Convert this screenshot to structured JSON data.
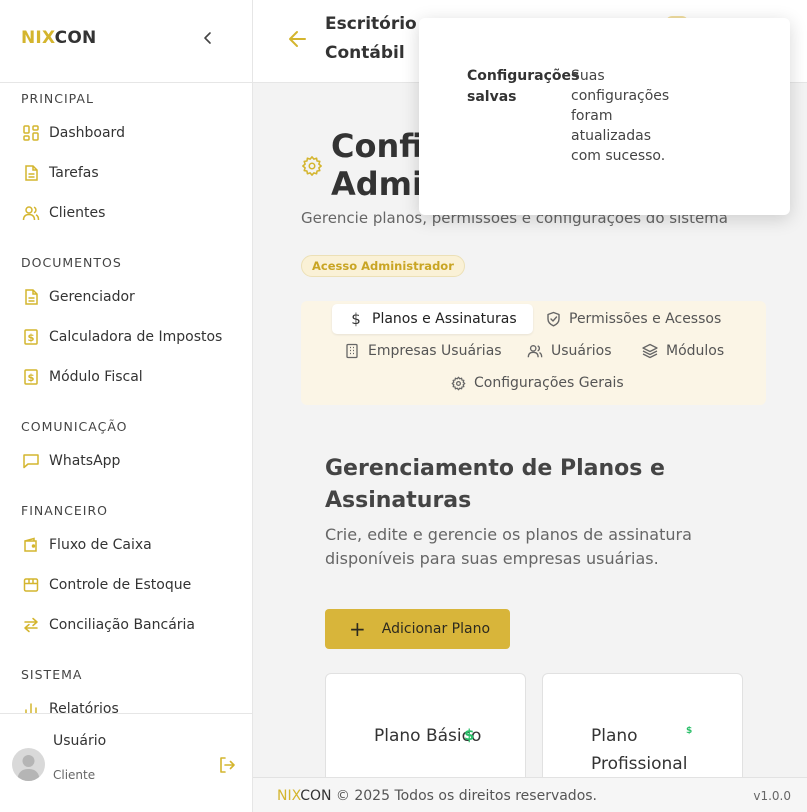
{
  "brand": {
    "part1": "NIX",
    "part2": "CON"
  },
  "sidebar": {
    "sections": [
      {
        "title": "PRINCIPAL",
        "items": [
          {
            "label": "Dashboard",
            "icon": "dashboard-icon"
          },
          {
            "label": "Tarefas",
            "icon": "file-icon"
          },
          {
            "label": "Clientes",
            "icon": "users-icon"
          }
        ]
      },
      {
        "title": "DOCUMENTOS",
        "items": [
          {
            "label": "Gerenciador",
            "icon": "file-icon"
          },
          {
            "label": "Calculadora de Impostos",
            "icon": "dollar-file-icon"
          },
          {
            "label": "Módulo Fiscal",
            "icon": "dollar-file-icon"
          }
        ]
      },
      {
        "title": "COMUNICAÇÃO",
        "items": [
          {
            "label": "WhatsApp",
            "icon": "chat-icon"
          }
        ]
      },
      {
        "title": "FINANCEIRO",
        "items": [
          {
            "label": "Fluxo de Caixa",
            "icon": "wallet-icon"
          },
          {
            "label": "Controle de Estoque",
            "icon": "box-icon"
          },
          {
            "label": "Conciliação Bancária",
            "icon": "swap-icon"
          }
        ]
      },
      {
        "title": "SISTEMA",
        "items": [
          {
            "label": "Relatórios",
            "icon": "bar-chart-icon"
          }
        ]
      }
    ],
    "user": {
      "name": "Usuário",
      "role": "Cliente"
    }
  },
  "header": {
    "title": "Escritório Contábil"
  },
  "main": {
    "page_title": "Configurações de Administrador",
    "page_subtitle": "Gerencie planos, permissões e configurações do sistema",
    "badge": "Acesso Administrador",
    "tabs": [
      {
        "label": "Planos e Assinaturas",
        "icon": "dollar-icon"
      },
      {
        "label": "Permissões e Acessos",
        "icon": "shield-icon"
      },
      {
        "label": "Empresas Usuárias",
        "icon": "building-icon"
      },
      {
        "label": "Usuários",
        "icon": "users-icon"
      },
      {
        "label": "Módulos",
        "icon": "layers-icon"
      },
      {
        "label": "Configurações Gerais",
        "icon": "gear-icon"
      }
    ],
    "section_title": "Gerenciamento de Planos e Assinaturas",
    "section_desc": "Crie, edite e gerencie os planos de assinatura disponíveis para suas empresas usuárias.",
    "add_button": "Adicionar Plano",
    "add_button_icon": "+",
    "plans": [
      {
        "name": "Plano Básico",
        "icon": "$"
      },
      {
        "name": "Plano Profissional",
        "icon": "$"
      }
    ]
  },
  "footer": {
    "text": " © 2025 Todos os direitos reservados.",
    "version": "v1.0.0"
  },
  "toast": {
    "title": "Configurações salvas",
    "message": "Suas configurações foram atualizadas com sucesso."
  },
  "colors": {
    "accent": "#d4b52e",
    "button": "#d8b53a",
    "success": "#2bbf6a"
  }
}
